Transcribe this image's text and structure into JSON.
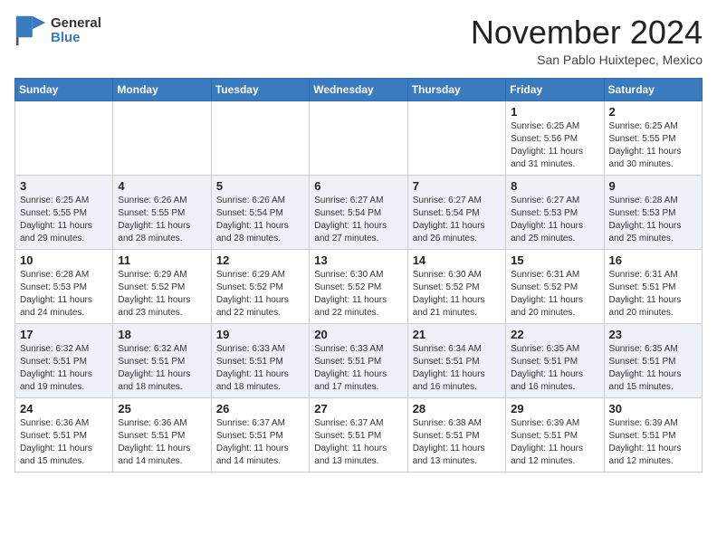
{
  "header": {
    "logo_line1": "General",
    "logo_line2": "Blue",
    "month": "November 2024",
    "location": "San Pablo Huixtepec, Mexico"
  },
  "weekdays": [
    "Sunday",
    "Monday",
    "Tuesday",
    "Wednesday",
    "Thursday",
    "Friday",
    "Saturday"
  ],
  "weeks": [
    [
      {
        "day": "",
        "info": ""
      },
      {
        "day": "",
        "info": ""
      },
      {
        "day": "",
        "info": ""
      },
      {
        "day": "",
        "info": ""
      },
      {
        "day": "",
        "info": ""
      },
      {
        "day": "1",
        "info": "Sunrise: 6:25 AM\nSunset: 5:56 PM\nDaylight: 11 hours and 31 minutes."
      },
      {
        "day": "2",
        "info": "Sunrise: 6:25 AM\nSunset: 5:55 PM\nDaylight: 11 hours and 30 minutes."
      }
    ],
    [
      {
        "day": "3",
        "info": "Sunrise: 6:25 AM\nSunset: 5:55 PM\nDaylight: 11 hours and 29 minutes."
      },
      {
        "day": "4",
        "info": "Sunrise: 6:26 AM\nSunset: 5:55 PM\nDaylight: 11 hours and 28 minutes."
      },
      {
        "day": "5",
        "info": "Sunrise: 6:26 AM\nSunset: 5:54 PM\nDaylight: 11 hours and 28 minutes."
      },
      {
        "day": "6",
        "info": "Sunrise: 6:27 AM\nSunset: 5:54 PM\nDaylight: 11 hours and 27 minutes."
      },
      {
        "day": "7",
        "info": "Sunrise: 6:27 AM\nSunset: 5:54 PM\nDaylight: 11 hours and 26 minutes."
      },
      {
        "day": "8",
        "info": "Sunrise: 6:27 AM\nSunset: 5:53 PM\nDaylight: 11 hours and 25 minutes."
      },
      {
        "day": "9",
        "info": "Sunrise: 6:28 AM\nSunset: 5:53 PM\nDaylight: 11 hours and 25 minutes."
      }
    ],
    [
      {
        "day": "10",
        "info": "Sunrise: 6:28 AM\nSunset: 5:53 PM\nDaylight: 11 hours and 24 minutes."
      },
      {
        "day": "11",
        "info": "Sunrise: 6:29 AM\nSunset: 5:52 PM\nDaylight: 11 hours and 23 minutes."
      },
      {
        "day": "12",
        "info": "Sunrise: 6:29 AM\nSunset: 5:52 PM\nDaylight: 11 hours and 22 minutes."
      },
      {
        "day": "13",
        "info": "Sunrise: 6:30 AM\nSunset: 5:52 PM\nDaylight: 11 hours and 22 minutes."
      },
      {
        "day": "14",
        "info": "Sunrise: 6:30 AM\nSunset: 5:52 PM\nDaylight: 11 hours and 21 minutes."
      },
      {
        "day": "15",
        "info": "Sunrise: 6:31 AM\nSunset: 5:52 PM\nDaylight: 11 hours and 20 minutes."
      },
      {
        "day": "16",
        "info": "Sunrise: 6:31 AM\nSunset: 5:51 PM\nDaylight: 11 hours and 20 minutes."
      }
    ],
    [
      {
        "day": "17",
        "info": "Sunrise: 6:32 AM\nSunset: 5:51 PM\nDaylight: 11 hours and 19 minutes."
      },
      {
        "day": "18",
        "info": "Sunrise: 6:32 AM\nSunset: 5:51 PM\nDaylight: 11 hours and 18 minutes."
      },
      {
        "day": "19",
        "info": "Sunrise: 6:33 AM\nSunset: 5:51 PM\nDaylight: 11 hours and 18 minutes."
      },
      {
        "day": "20",
        "info": "Sunrise: 6:33 AM\nSunset: 5:51 PM\nDaylight: 11 hours and 17 minutes."
      },
      {
        "day": "21",
        "info": "Sunrise: 6:34 AM\nSunset: 5:51 PM\nDaylight: 11 hours and 16 minutes."
      },
      {
        "day": "22",
        "info": "Sunrise: 6:35 AM\nSunset: 5:51 PM\nDaylight: 11 hours and 16 minutes."
      },
      {
        "day": "23",
        "info": "Sunrise: 6:35 AM\nSunset: 5:51 PM\nDaylight: 11 hours and 15 minutes."
      }
    ],
    [
      {
        "day": "24",
        "info": "Sunrise: 6:36 AM\nSunset: 5:51 PM\nDaylight: 11 hours and 15 minutes."
      },
      {
        "day": "25",
        "info": "Sunrise: 6:36 AM\nSunset: 5:51 PM\nDaylight: 11 hours and 14 minutes."
      },
      {
        "day": "26",
        "info": "Sunrise: 6:37 AM\nSunset: 5:51 PM\nDaylight: 11 hours and 14 minutes."
      },
      {
        "day": "27",
        "info": "Sunrise: 6:37 AM\nSunset: 5:51 PM\nDaylight: 11 hours and 13 minutes."
      },
      {
        "day": "28",
        "info": "Sunrise: 6:38 AM\nSunset: 5:51 PM\nDaylight: 11 hours and 13 minutes."
      },
      {
        "day": "29",
        "info": "Sunrise: 6:39 AM\nSunset: 5:51 PM\nDaylight: 11 hours and 12 minutes."
      },
      {
        "day": "30",
        "info": "Sunrise: 6:39 AM\nSunset: 5:51 PM\nDaylight: 11 hours and 12 minutes."
      }
    ]
  ]
}
